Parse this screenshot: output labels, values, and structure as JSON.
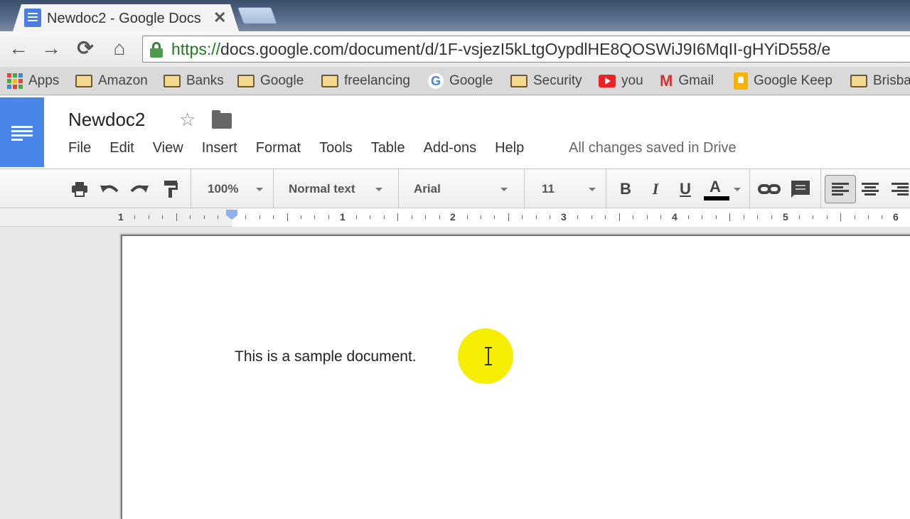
{
  "browser": {
    "tab": {
      "title": "Newdoc2 - Google Docs",
      "close_symbol": "✕"
    },
    "nav": {
      "back": "←",
      "forward": "→",
      "reload": "⟳",
      "home": "⌂"
    },
    "url": {
      "scheme": "https://",
      "rest": "docs.google.com/document/d/1F-vsjezI5kLtgOypdlHE8QOSWiJ9I6MqII-gHYiD558/e"
    },
    "bookmarks": [
      {
        "label": "Apps",
        "icon": "apps-grid-icon"
      },
      {
        "label": "Amazon",
        "icon": "folder-icon"
      },
      {
        "label": "Banks",
        "icon": "folder-icon"
      },
      {
        "label": "Google",
        "icon": "folder-icon"
      },
      {
        "label": "freelancing",
        "icon": "folder-icon"
      },
      {
        "label": "Google",
        "icon": "google-g-icon"
      },
      {
        "label": "Security",
        "icon": "folder-icon"
      },
      {
        "label": "you",
        "icon": "youtube-icon"
      },
      {
        "label": "Gmail",
        "icon": "gmail-icon"
      },
      {
        "label": "Google Keep",
        "icon": "keep-icon"
      },
      {
        "label": "Brisba",
        "icon": "folder-icon"
      }
    ]
  },
  "docs": {
    "title": "Newdoc2",
    "star": "☆",
    "menu": [
      "File",
      "Edit",
      "View",
      "Insert",
      "Format",
      "Tools",
      "Table",
      "Add-ons",
      "Help"
    ],
    "save_status": "All changes saved in Drive",
    "toolbar": {
      "zoom": "100%",
      "style": "Normal text",
      "font": "Arial",
      "size": "11",
      "bold": "B",
      "italic": "I",
      "underline": "U",
      "text_color": "A"
    },
    "ruler": {
      "labels": [
        "1",
        "1",
        "2",
        "3",
        "4",
        "5",
        "6"
      ]
    },
    "body_text": "This is a sample document.",
    "colors": {
      "brand": "#4a86e8",
      "highlight": "#f5ee00"
    }
  }
}
